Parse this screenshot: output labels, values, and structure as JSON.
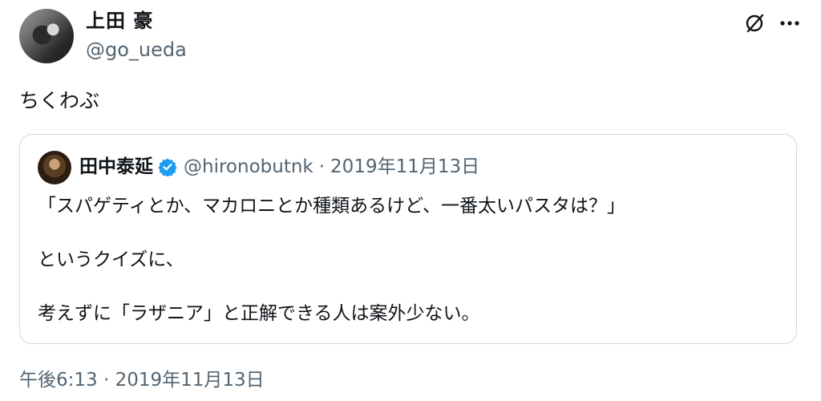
{
  "tweet": {
    "author": {
      "name": "上田 豪",
      "handle": "@go_ueda"
    },
    "text": "ちくわぶ",
    "time": "午後6:13",
    "separator": "·",
    "date": "2019年11月13日"
  },
  "quoted": {
    "author": {
      "name": "田中泰延",
      "handle": "@hironobutnk",
      "verified": true
    },
    "separator": "·",
    "date": "2019年11月13日",
    "lines": [
      "「スパゲティとか、マカロニとか種類あるけど、一番太いパスタは？」",
      "というクイズに、",
      "考えずに「ラザニア」と正解できる人は案外少ない。"
    ]
  },
  "icons": {
    "header": [
      "grok-slash-icon",
      "more-icon"
    ],
    "verified": "verified-badge-icon"
  },
  "colors": {
    "text": "#0f1419",
    "secondary": "#536471",
    "border": "#cfd9de",
    "verified": "#1d9bf0"
  }
}
